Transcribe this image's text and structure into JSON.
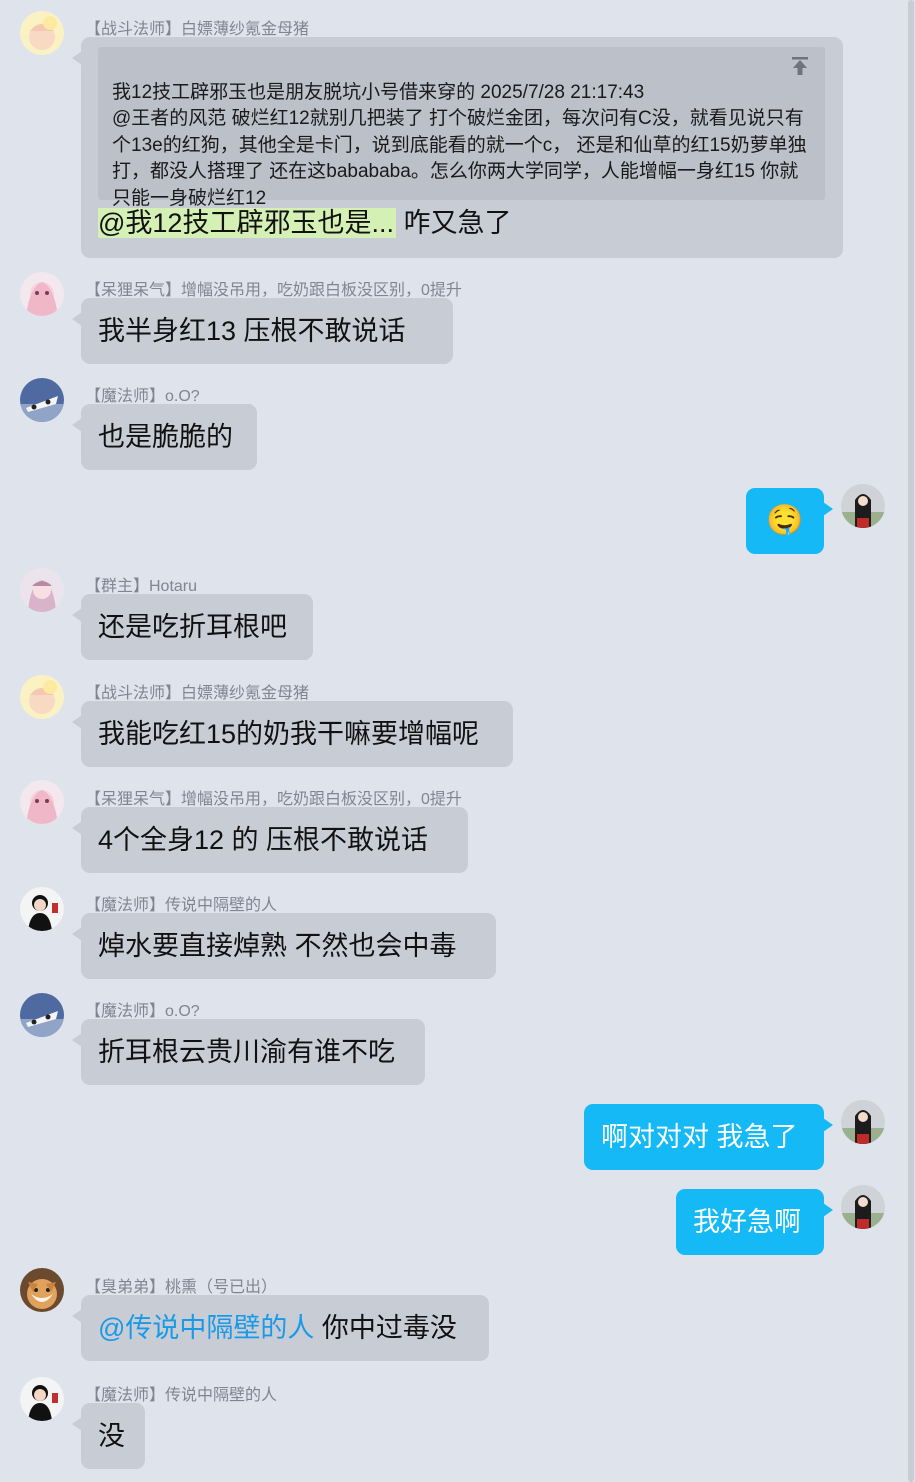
{
  "messages": {
    "m1": {
      "sender": "【战斗法师】白嫖薄纱氪金母猪",
      "quote_text": "我12技工辟邪玉也是朋友脱坑小号借来穿的  2025/7/28 21:17:43\n@王者的风范  破烂红12就别几把装了 打个破烂金团，每次问有C没，就看见说只有个13e的红狗，其他全是卡门，说到底能看的就一个c，  还是和仙草的红15奶萝单独打，都没人搭理了 还在这babababa。怎么你两大学同学，人能增幅一身红15 你就只能一身破烂红12",
      "reply_mention": "@我12技工辟邪玉也是...",
      "reply_text": " 咋又急了"
    },
    "m2": {
      "sender": "【呆狸呆气】增幅没吊用，吃奶跟白板没区别，0提升",
      "text": "我半身红13   压根不敢说话"
    },
    "m3": {
      "sender": "【魔法师】o.O?",
      "text": "也是脆脆的"
    },
    "m4": {
      "emoji": "🤤"
    },
    "m5": {
      "sender": "【群主】Hotaru",
      "text": "还是吃折耳根吧"
    },
    "m6": {
      "sender": "【战斗法师】白嫖薄纱氪金母猪",
      "text": "我能吃红15的奶我干嘛要增幅呢"
    },
    "m7": {
      "sender": "【呆狸呆气】增幅没吊用，吃奶跟白板没区别，0提升",
      "text": "4个全身12 的  压根不敢说话"
    },
    "m8": {
      "sender": "【魔法师】传说中隔壁的人",
      "text": "焯水要直接焯熟  不然也会中毒"
    },
    "m9": {
      "sender": "【魔法师】o.O?",
      "text": "折耳根云贵川渝有谁不吃"
    },
    "m10": {
      "text": "啊对对对 我急了"
    },
    "m11": {
      "text": "我好急啊"
    },
    "m12": {
      "sender": "【臭弟弟】桃熏（号已出）",
      "mention": "@传说中隔壁的人",
      "text": " 你中过毒没"
    },
    "m13": {
      "sender": "【魔法师】传说中隔壁的人",
      "text": "没"
    }
  },
  "colors": {
    "background": "#dfe3ec",
    "bubble_other": "#c8ccd5",
    "bubble_mine": "#14b9f5",
    "mention": "#1a9ae6"
  }
}
